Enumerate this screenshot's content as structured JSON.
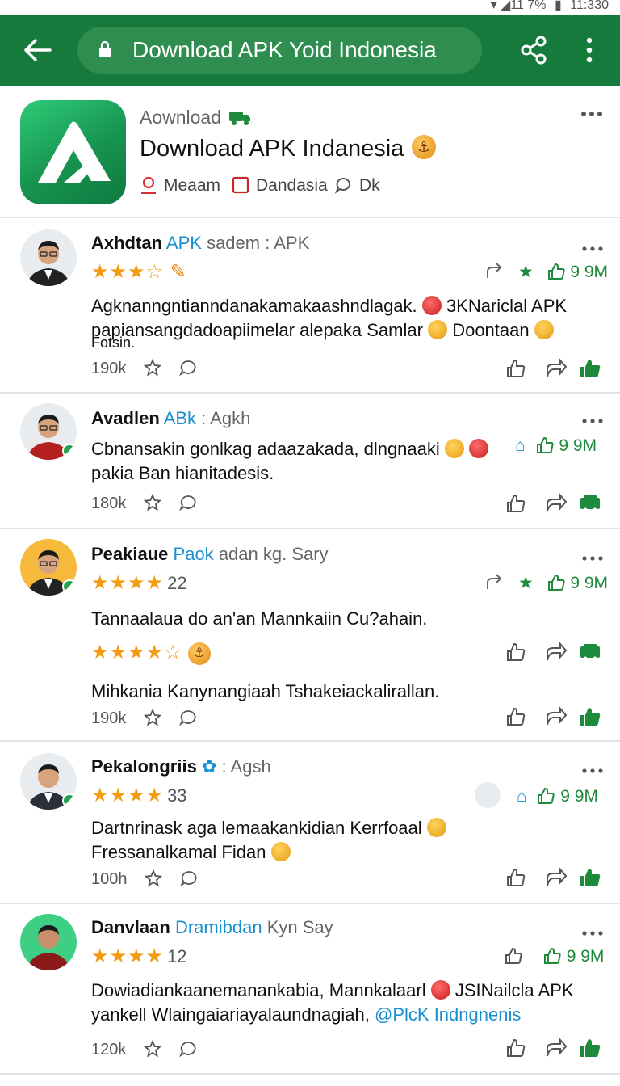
{
  "status_bar": {
    "signal": "▾ ◢11 7%",
    "battery": "▮",
    "time": "11:330"
  },
  "app_bar": {
    "url_text": "Download APK Yoid Indonesia",
    "icons": [
      "back-arrow-icon",
      "lock-icon",
      "share-icon",
      "more-vert-icon"
    ]
  },
  "app": {
    "kicker": "Aownload",
    "title": "Download APK Indanesia",
    "meta": [
      "Meaam",
      "Dandasia",
      "Dk"
    ],
    "colors": {
      "brand_green": "#167a3d",
      "logo_green": "#17934f"
    }
  },
  "reviews": [
    {
      "name": "Axhdtan",
      "tag": "APK",
      "rest": "sadem : APK",
      "stars": "★★★☆",
      "star_count": "",
      "stat": "9 9M",
      "text_1": "Agknanngntianndanakamakaashndlagak.",
      "text_1b": "3KNariclal APK",
      "text_2": "papiansangdadoapiimelar alepaka Samlar",
      "text_2b": "Doontaan",
      "text_3": "Fotsin.",
      "footer_count": "190k"
    },
    {
      "name": "Avadlen",
      "tag": "ABk",
      "rest": ": Agkh",
      "stat": "9 9M",
      "text_1": "Cbnansakin gonlkag adaazakada, dlngnaaki",
      "text_2": "pakia Ban hianitadesis.",
      "footer_count": "180k"
    },
    {
      "name": "Peakiaue",
      "tag": "Paok",
      "rest": "adan kg. Sary",
      "stars": "★★★★",
      "star_count": "22",
      "stat": "9 9M",
      "text_1": "Tannaalaua do an'an Mannkaiin Cu?ahain.",
      "stars_2": "★★★★☆",
      "text_2": "Mihkania Kanynangiaah Tshakeiackalirallan.",
      "footer_count": "190k"
    },
    {
      "name": "Pekalongriis",
      "rest": ": Agsh",
      "stars": "★★★★",
      "star_count": "33",
      "stat": "9 9M",
      "text_1": "Dartnrinask aga lemaakankidian Kerrfoaal",
      "text_2": "Fressanalkamal Fidan",
      "footer_count": "100h"
    },
    {
      "name": "Danvlaan",
      "tag": "Dramibdan",
      "rest": "Kyn Say",
      "stars": "★★★★",
      "star_count": "12",
      "stat": "9 9M",
      "text_1": "Dowiadiankaanemanankabia, Mannkalaarl",
      "text_1b": "JSINailcla APK",
      "text_2": "yankell Wlaingaiariayalaundnagiah,",
      "text_2b": "@PlcK Indngnenis",
      "footer_count": "120k"
    }
  ]
}
